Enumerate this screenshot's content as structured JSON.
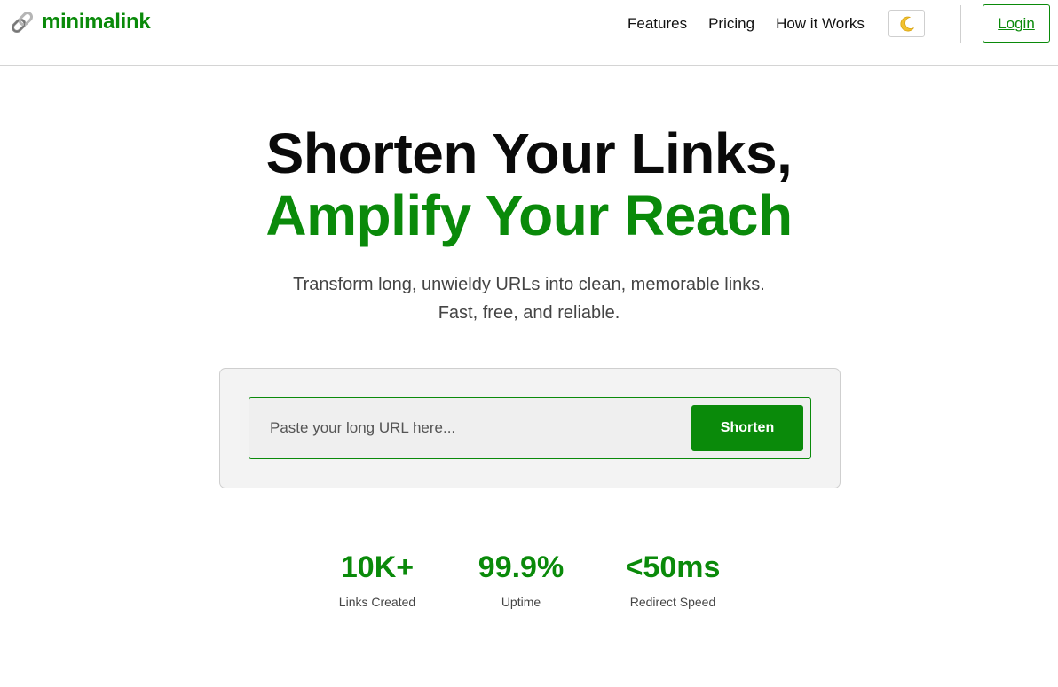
{
  "header": {
    "brand_name": "minimalink",
    "brand_icon": "link-icon",
    "nav_links": [
      "Features",
      "Pricing",
      "How it Works"
    ],
    "theme_toggle_icon": "moon-icon",
    "theme_toggle_glyph": "🌙",
    "login_label": "Login"
  },
  "hero": {
    "title_line1": "Shorten Your Links,",
    "title_line2": "Amplify Your Reach",
    "subtitle_line1": "Transform long, unwieldy URLs into clean, memorable links.",
    "subtitle_line2": "Fast, free, and reliable."
  },
  "shortener": {
    "url_placeholder": "Paste your long URL here...",
    "url_value": "",
    "shorten_label": "Shorten"
  },
  "stats": [
    {
      "value": "10K+",
      "label": "Links Created"
    },
    {
      "value": "99.9%",
      "label": "Uptime"
    },
    {
      "value": "<50ms",
      "label": "Redirect Speed"
    }
  ],
  "colors": {
    "brand_green": "#0a8a0a",
    "text_dark": "#0a0a0a",
    "text_muted": "#444444",
    "card_bg": "#f3f3f3",
    "border": "#cfcfcf"
  }
}
